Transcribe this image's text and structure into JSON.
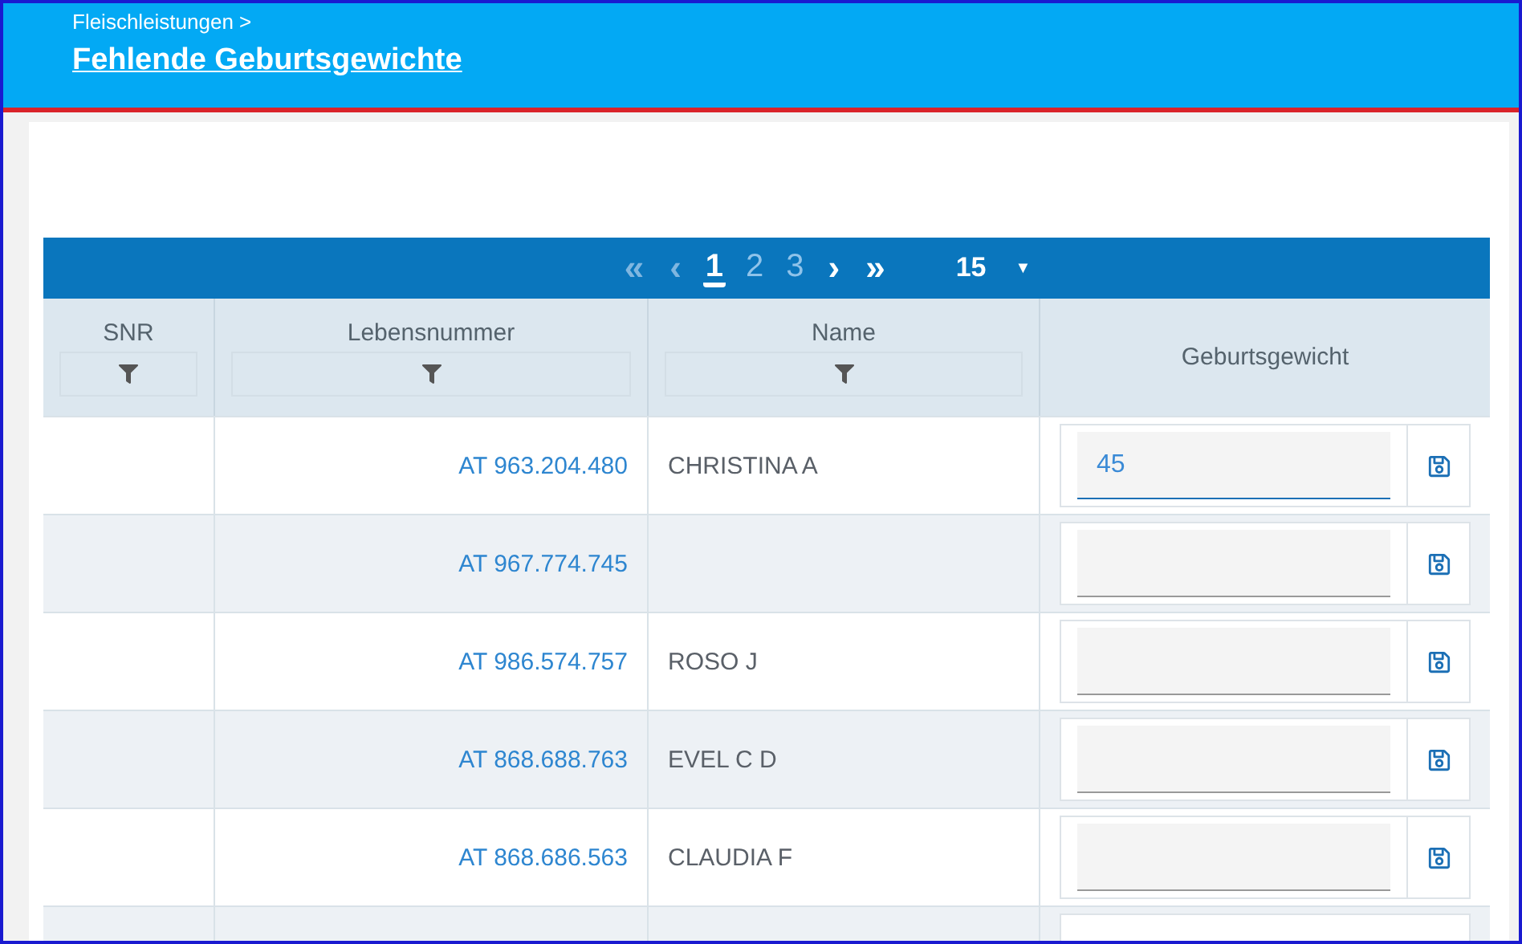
{
  "header": {
    "breadcrumb": "Fleischleistungen >",
    "title": "Fehlende Geburtsgewichte"
  },
  "pager": {
    "first": "«",
    "prev": "‹",
    "next": "›",
    "last": "»",
    "page_size": "15",
    "page_size_caret": "▼",
    "pages": [
      {
        "label": "1",
        "selected": true
      },
      {
        "label": "2",
        "selected": false
      },
      {
        "label": "3",
        "selected": false
      }
    ]
  },
  "table": {
    "columns": [
      {
        "label": "SNR",
        "filter": true
      },
      {
        "label": "Lebensnummer",
        "filter": true
      },
      {
        "label": "Name",
        "filter": true
      },
      {
        "label": "Geburtsgewicht",
        "filter": false
      }
    ],
    "rows": [
      {
        "lebensnummer": "AT 963.204.480",
        "name": "CHRISTINA A",
        "geburtsgewicht": "45",
        "focused": true
      },
      {
        "lebensnummer": "AT 967.774.745",
        "focused": false
      },
      {
        "lebensnummer": "AT 986.574.757",
        "name": "ROSO J",
        "focused": false
      },
      {
        "lebensnummer": "AT 868.688.763",
        "name": "EVEL C D",
        "focused": false
      },
      {
        "lebensnummer": "AT 868.686.563",
        "name": "CLAUDIA F",
        "focused": false
      }
    ]
  }
}
